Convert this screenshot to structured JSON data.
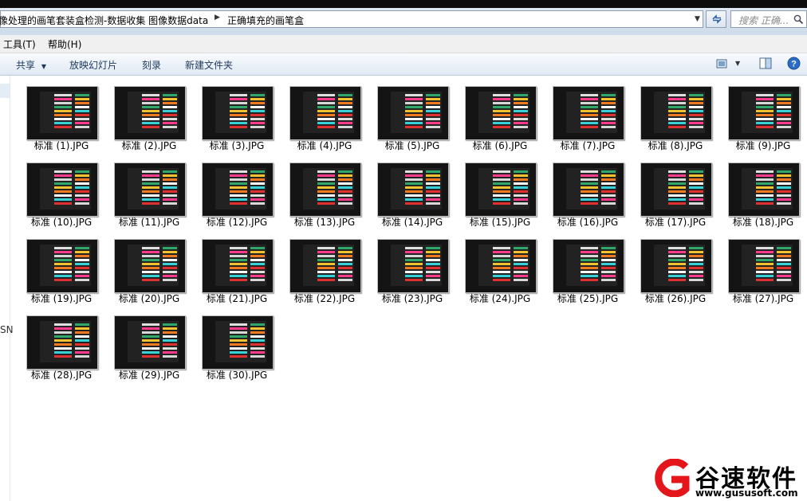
{
  "address": {
    "path": "像处理的画笔套装盒检测-数据收集 图像数据data",
    "current": "正确填充的画笔盒",
    "separator": "▶",
    "dropdown": "▼"
  },
  "search": {
    "placeholder": "搜索 正确..."
  },
  "menu": {
    "items": [
      "工具(T)",
      "帮助(H)"
    ]
  },
  "toolbar": {
    "share": "共享",
    "share_arrow": "▼",
    "slideshow": "放映幻灯片",
    "burn": "刻录",
    "new_folder": "新建文件夹",
    "view_arrow": "▼"
  },
  "nav": {
    "fragment": "SN"
  },
  "files": [
    "标准 (1).JPG",
    "标准 (2).JPG",
    "标准 (3).JPG",
    "标准 (4).JPG",
    "标准 (5).JPG",
    "标准 (6).JPG",
    "标准 (7).JPG",
    "标准 (8).JPG",
    "标准 (9).JPG",
    "标准 (10).JPG",
    "标准 (11).JPG",
    "标准 (12).JPG",
    "标准 (13).JPG",
    "标准 (14).JPG",
    "标准 (15).JPG",
    "标准 (16).JPG",
    "标准 (17).JPG",
    "标准 (18).JPG",
    "标准 (19).JPG",
    "标准 (20).JPG",
    "标准 (21).JPG",
    "标准 (22).JPG",
    "标准 (23).JPG",
    "标准 (24).JPG",
    "标准 (25).JPG",
    "标准 (26).JPG",
    "标准 (27).JPG",
    "标准 (28).JPG",
    "标准 (29).JPG",
    "标准 (30).JPG"
  ],
  "watermark": {
    "name": "谷速软件",
    "url": "www.gususoft.com"
  },
  "colors": {
    "accent": "#1e395b",
    "logo_red": "#e4161b",
    "thumb_bg": "#141414"
  }
}
